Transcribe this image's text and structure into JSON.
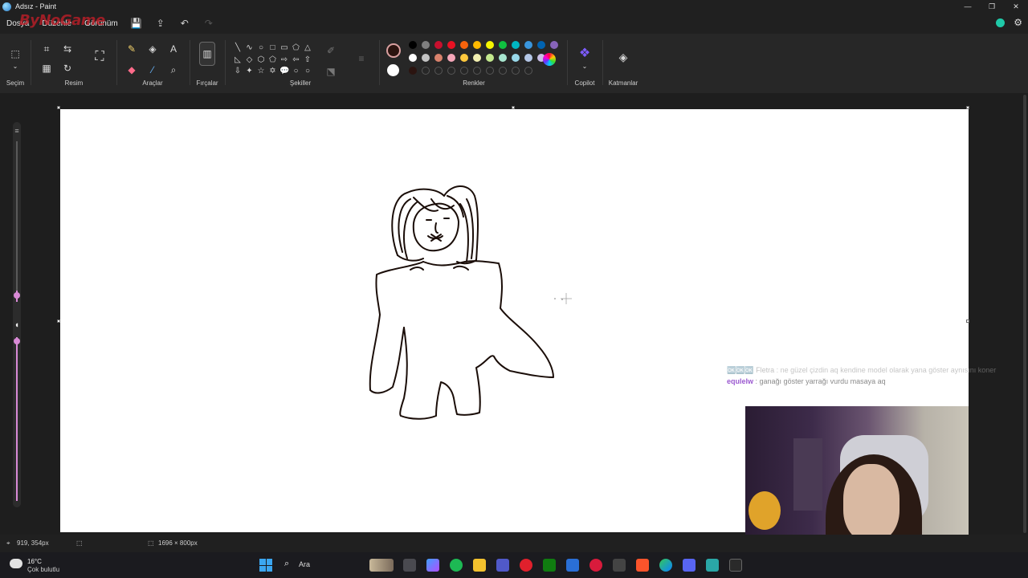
{
  "window": {
    "title": "Adsız - Paint",
    "minimize": "—",
    "maximize": "❐",
    "close": "✕"
  },
  "menu": {
    "items": [
      "Dosya",
      "Düzenle",
      "Görünüm"
    ],
    "save_icon": "💾",
    "share_icon": "⇪",
    "undo_icon": "↶",
    "redo_icon": "↷"
  },
  "watermark": "ByNoGame",
  "ribbon": {
    "groups": {
      "selection": "Seçim",
      "image": "Resim",
      "tools": "Araçlar",
      "brushes": "Fırçalar",
      "shapes": "Şekiller",
      "colors": "Renkler",
      "copilot": "Copilot",
      "layers": "Katmanlar"
    },
    "shape_glyphs": [
      "╲",
      "∿",
      "○",
      "□",
      "▭",
      "⬠",
      "△",
      "◺",
      "◇",
      "⬡",
      "⬠",
      "⇨",
      "⇦",
      "⇧",
      "⇩",
      "✦",
      "☆",
      "✡",
      "💬",
      "○",
      "○"
    ],
    "palette_row1": [
      "#000000",
      "#7f7f7f",
      "#c8102e",
      "#e81123",
      "#f7630c",
      "#ffb900",
      "#f5f500",
      "#10c040",
      "#00b7c3",
      "#3a96dd",
      "#0063b1",
      "#8764b8"
    ],
    "palette_row2": [
      "#ffffff",
      "#c3c3c3",
      "#d9826c",
      "#f4a6b8",
      "#ffc83d",
      "#f2efb0",
      "#c3e88d",
      "#a8e6cf",
      "#99d9ea",
      "#b4c7e7",
      "#c8bfe7"
    ],
    "primary_color": "#2b1410",
    "secondary_color": "#ffffff"
  },
  "canvas": {
    "background": "#ffffff"
  },
  "chat": {
    "line1_user": "🆗🆗🆗 Fletra",
    "line1_msg": ": ne güzel çizdin aq kendine model olarak yana göster aynısını koner",
    "line2_user": "equlelw",
    "line2_msg": ": ganağı göster yarrağı vurdu masaya aq"
  },
  "status": {
    "cursor_pos": "919, 354px",
    "canvas_size": "1696 × 800px"
  },
  "taskbar": {
    "temperature": "16°C",
    "weather": "Çok bulutlu",
    "search": "Ara"
  }
}
